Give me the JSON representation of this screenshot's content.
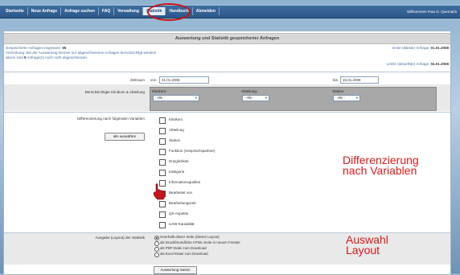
{
  "nav": {
    "items": [
      "Startseite",
      "Neue Anfrage",
      "Anfrage suchen",
      "FAQ",
      "Verwaltung",
      "Statistik",
      "Handbuch",
      "Abmelden"
    ],
    "active": "Statistik",
    "welcome": "Willkommen Frau G. Quernach"
  },
  "header": {
    "title": "Auswertung und Statistik gespeicherter Anfragen"
  },
  "info": {
    "count_label": "Gespeicherte Anfragen insgesamt:",
    "count": "55",
    "note_line1": "Anmerkung: Bei der Auswertung können nur abgeschlossene Anfragen berücksichtigt werden!",
    "note_line2_a": "davon sind",
    "note_line2_b": "9",
    "note_line2_c": "Anfrage(n) noch nicht abgeschlossen.",
    "first_label": "Erste (älteste) Anfrage:",
    "first_date": "01.01.2008",
    "last_label": "Letzte (aktuellste) Anfrage:",
    "last_date": "04.01.2008"
  },
  "zeitraum": {
    "label": "Zeitraum",
    "von_label": "von",
    "von_value": "01.01.2008",
    "bis_label": "bis",
    "bis_value": "15.01.2008"
  },
  "klinikum": {
    "label": "Berücksichtigte Klinikum & Abteilung",
    "klinikum_caption": "Klinikum:",
    "abteilung_caption": "Abteilung:",
    "station_caption": "Station:",
    "default_option": "- Alle -"
  },
  "variablen": {
    "label": "Differenzierung nach folgenden Variablen",
    "select_all": "alle auswählen",
    "items": [
      "Klinikum",
      "Abteilung",
      "Station",
      "Funktion (Gesprächspartner)",
      "Dringlichkeit",
      "Kategorie",
      "Informationsquellen",
      "Bearbeitet von",
      "Bearbeitungszeit",
      "QS-Aspekte",
      "UAW-Kausalität"
    ]
  },
  "layout": {
    "label": "Ausgabe (Layout) der Statistik",
    "options": [
      "innerhalb dieser Seite (dieses Layout)",
      "als Druckfreundliche HTML-Seite in neuem Fenster",
      "als PDF-Datei zum Download",
      "als Excel-Datei zum Download"
    ],
    "selected": 0,
    "start_button": "Auswertung starten"
  },
  "annotations": {
    "variablen_line1": "Differenzierung",
    "variablen_line2": "nach Variablen",
    "layout_line1": "Auswahl",
    "layout_line2": "Layout"
  },
  "colors": {
    "accent_red": "#d81b1b",
    "nav_blue": "#2b5789"
  }
}
